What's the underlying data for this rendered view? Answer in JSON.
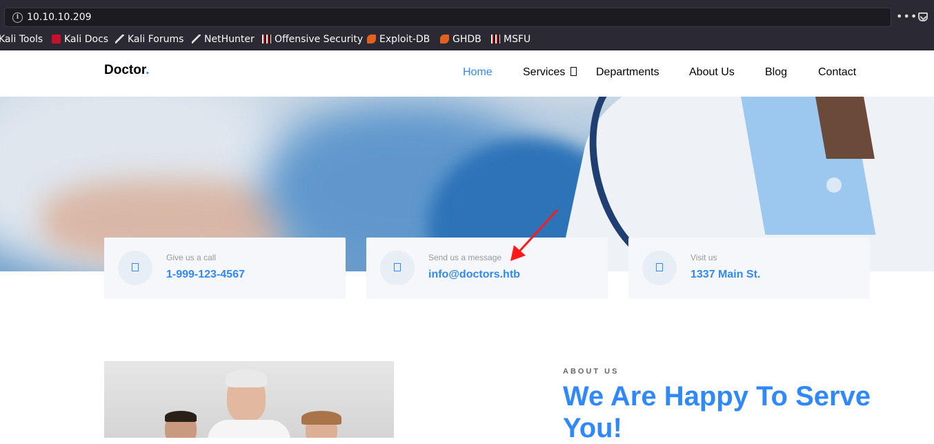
{
  "browser": {
    "url": "10.10.10.209",
    "more_icon": "more-icon",
    "bookmarks": [
      "Kali Tools",
      "Kali Docs",
      "Kali Forums",
      "NetHunter",
      "Offensive Security",
      "Exploit-DB",
      "GHDB",
      "MSFU"
    ]
  },
  "site": {
    "logo": "Doctor",
    "logo_dot": ".",
    "nav": [
      "Home",
      "Services",
      "Departments",
      "About Us",
      "Blog",
      "Contact"
    ],
    "accent_color": "#2f89fc"
  },
  "cards": [
    {
      "label": "Give us a call",
      "value": "1-999-123-4567"
    },
    {
      "label": "Send us a message",
      "value": "info@doctors.htb"
    },
    {
      "label": "Visit us",
      "value": "1337 Main St."
    }
  ],
  "about": {
    "subheading": "ABOUT US",
    "title": "We Are Happy To Serve You!"
  },
  "annotation_color": "#ff1a1a"
}
